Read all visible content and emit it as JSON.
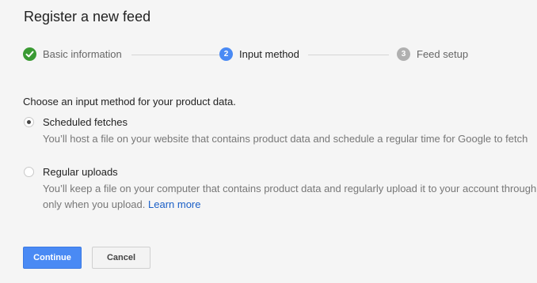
{
  "header": {
    "title": "Register a new feed"
  },
  "stepper": {
    "steps": [
      {
        "number": "",
        "label": "Basic information",
        "state": "done"
      },
      {
        "number": "2",
        "label": "Input method",
        "state": "current"
      },
      {
        "number": "3",
        "label": "Feed setup",
        "state": "pending"
      }
    ]
  },
  "form": {
    "prompt": "Choose an input method for your product data.",
    "options": [
      {
        "label": "Scheduled fetches",
        "selected": true,
        "description_line1": "You’ll host a file on your website that contains product data and schedule a regular time for Google to fetch"
      },
      {
        "label": "Regular uploads",
        "selected": false,
        "description_line1": "You’ll keep a file on your computer that contains product data and regularly upload it to your account through",
        "description_line2": "only when you upload.",
        "link_text": "Learn more"
      }
    ]
  },
  "actions": {
    "continue_label": "Continue",
    "cancel_label": "Cancel"
  },
  "colors": {
    "accent": "#4a8af4",
    "done": "#3a9a33",
    "link": "#1a5fc7"
  },
  "icons": {
    "step1": "check-icon"
  }
}
